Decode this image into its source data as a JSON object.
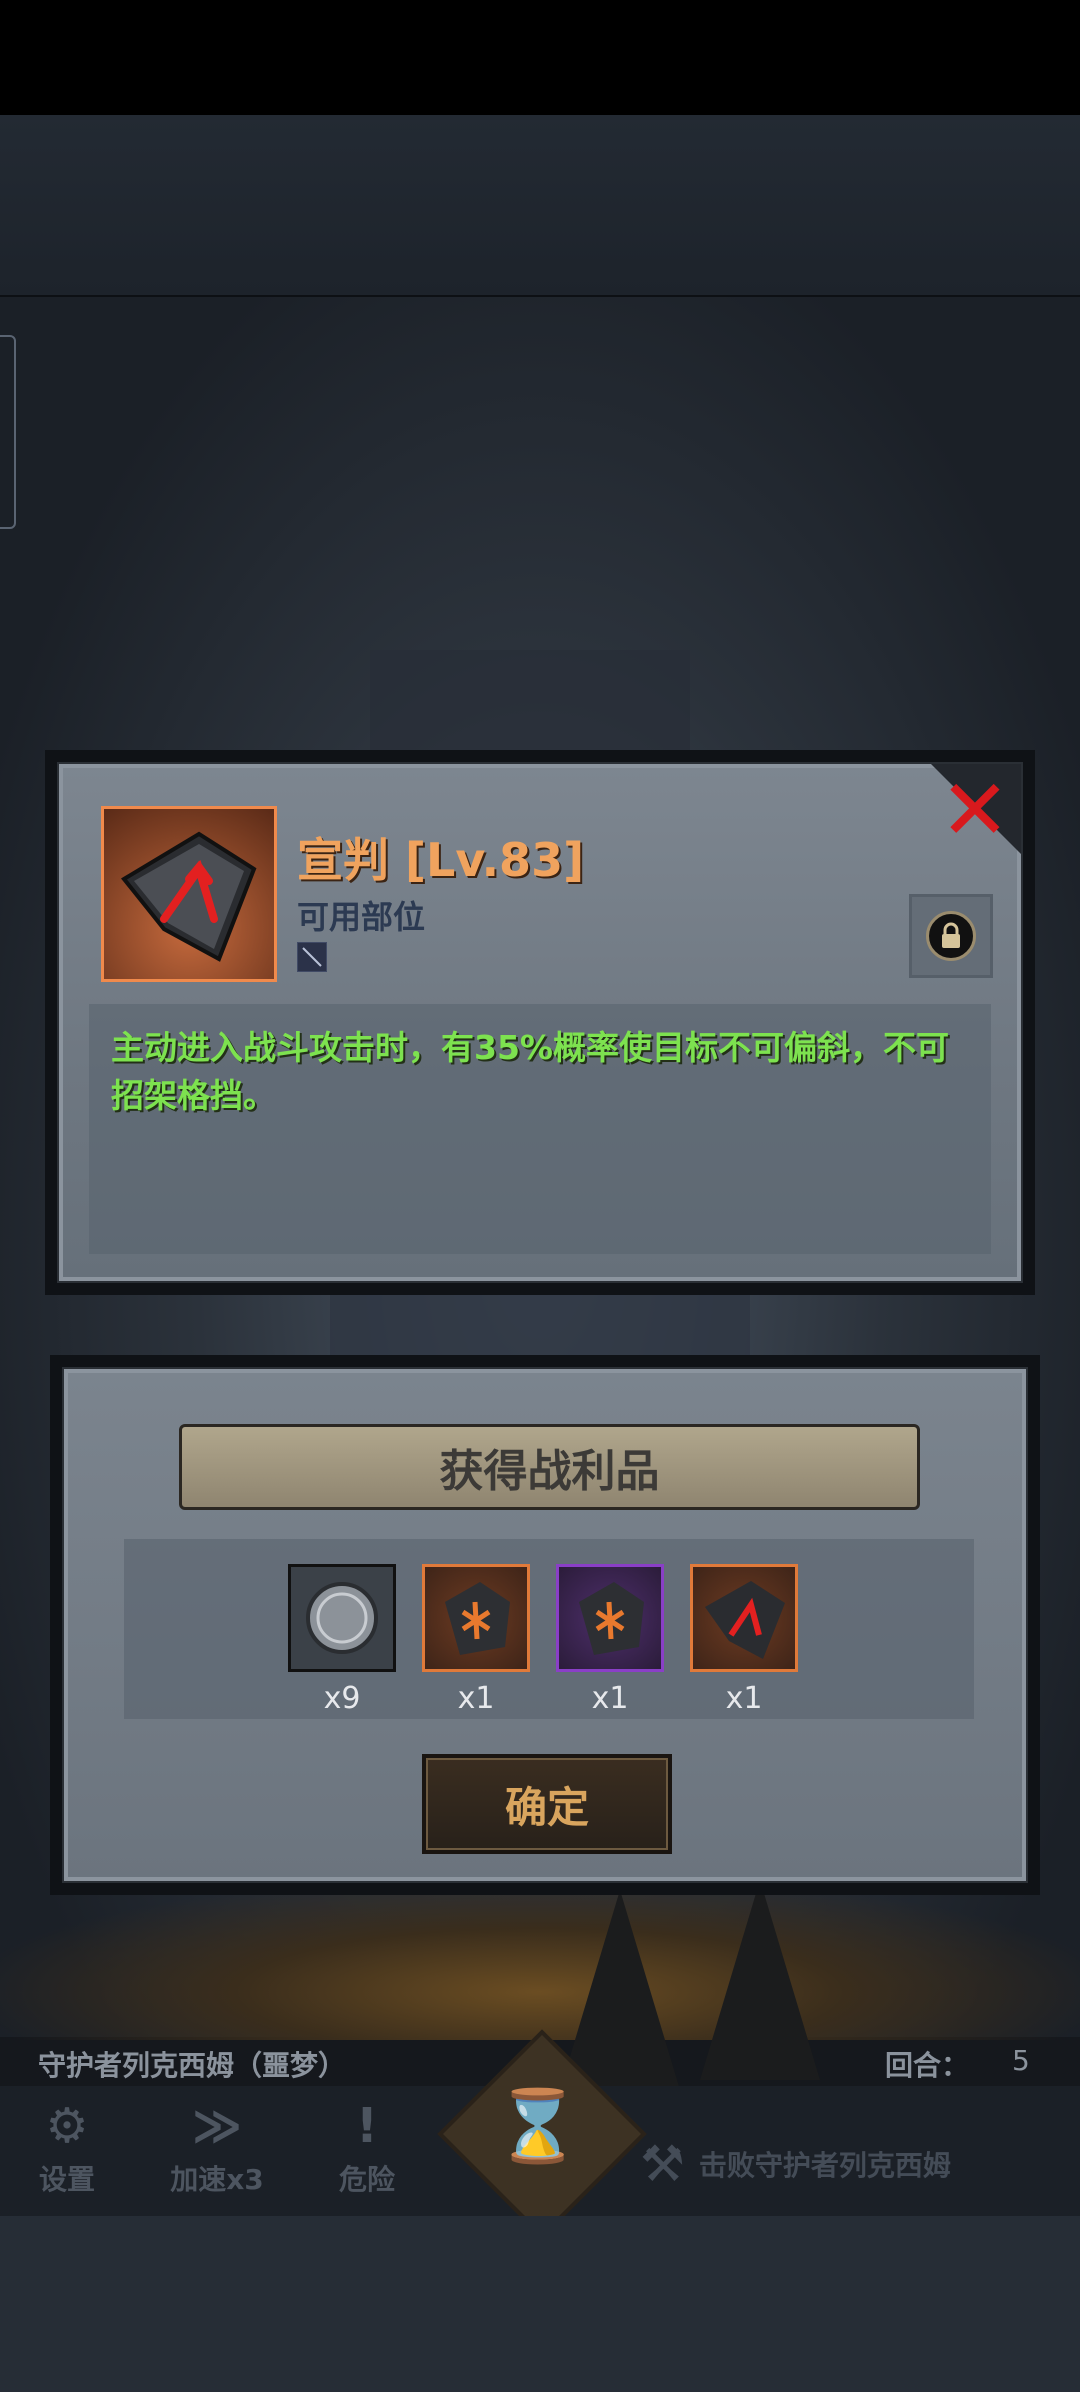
{
  "item": {
    "title": "宣判 [Lv.83]",
    "slot_label": "可用部位",
    "description": "主动进入战斗攻击时，有35%概率使目标不可偏斜，不可招架格挡。",
    "icon": "rune-stone-red-arrow-icon",
    "close_icon": "close-x-icon",
    "lock_icon": "lock-icon"
  },
  "loot": {
    "title": "获得战利品",
    "items": [
      {
        "icon": "silver-coin-icon",
        "count": "x9",
        "border": "#111111"
      },
      {
        "icon": "rune-orange-icon",
        "count": "x1",
        "border": "#e07a3a"
      },
      {
        "icon": "rune-purple-icon",
        "count": "x1",
        "border": "#8a3fc7"
      },
      {
        "icon": "rune-red-arrow-icon",
        "count": "x1",
        "border": "#e07a3a"
      }
    ],
    "confirm_label": "确定"
  },
  "status": {
    "boss_name": "守护者列克西姆（噩梦）",
    "round_label": "回合：",
    "round_value": "5"
  },
  "toolbar": {
    "settings_label": "设置",
    "speed_label": "加速x3",
    "danger_label": "危险",
    "goal_text": "击败守护者列克西姆"
  },
  "colors": {
    "title_orange": "#f0a35e",
    "desc_green": "#7de24f",
    "close_red": "#d8191d"
  }
}
